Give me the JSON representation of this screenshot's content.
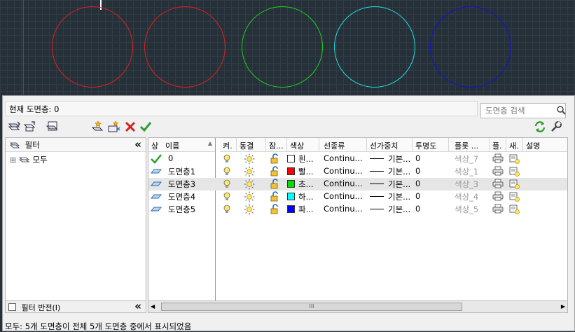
{
  "canvas": {
    "circle_colors": [
      "#e02020",
      "#e02020",
      "#20d020",
      "#20e0e0",
      "#1010e0"
    ]
  },
  "header": {
    "current_layer": "현재 도면층: 0",
    "search_placeholder": "도면층 검색"
  },
  "filter_pane": {
    "title": "필터",
    "collapse_glyph": "«",
    "tree_all": "모두",
    "expand_glyph": "⊞",
    "invert_label": "필터 반전(I)"
  },
  "columns": {
    "status": "상",
    "name": "이름",
    "on": "켜.",
    "freeze": "동결",
    "lock": "잠...",
    "color": "색상",
    "linetype": "선종류",
    "lineweight": "선가중치",
    "transparency": "투명도",
    "plot_style": "플롯 ...",
    "plot": "플.",
    "new_vp": "새.",
    "description": "설명"
  },
  "layers": [
    {
      "name": "0",
      "color_name": "흰...",
      "color_hex": "#ffffff",
      "linetype": "Continu...",
      "lineweight": "기본...",
      "transparency": "0",
      "plot_style": "색상_7",
      "current": true,
      "selected": false
    },
    {
      "name": "도면층1",
      "color_name": "빨...",
      "color_hex": "#ff0000",
      "linetype": "Continu...",
      "lineweight": "기본...",
      "transparency": "0",
      "plot_style": "색상_1",
      "current": false,
      "selected": false
    },
    {
      "name": "도면층3",
      "color_name": "초...",
      "color_hex": "#00e000",
      "linetype": "Continu...",
      "lineweight": "기본...",
      "transparency": "0",
      "plot_style": "색상_3",
      "current": false,
      "selected": true
    },
    {
      "name": "도면층4",
      "color_name": "하...",
      "color_hex": "#00ffff",
      "linetype": "Continu...",
      "lineweight": "기본...",
      "transparency": "0",
      "plot_style": "색상_4",
      "current": false,
      "selected": false
    },
    {
      "name": "도면층5",
      "color_name": "파...",
      "color_hex": "#0000ff",
      "linetype": "Continu...",
      "lineweight": "기본...",
      "transparency": "0",
      "plot_style": "색상_5",
      "current": false,
      "selected": false
    }
  ],
  "scroll": {
    "thumb_glyph": "III"
  },
  "status_bar": "모두: 5개 도면층이 전체 5개 도면층 중에서 표시되었음"
}
